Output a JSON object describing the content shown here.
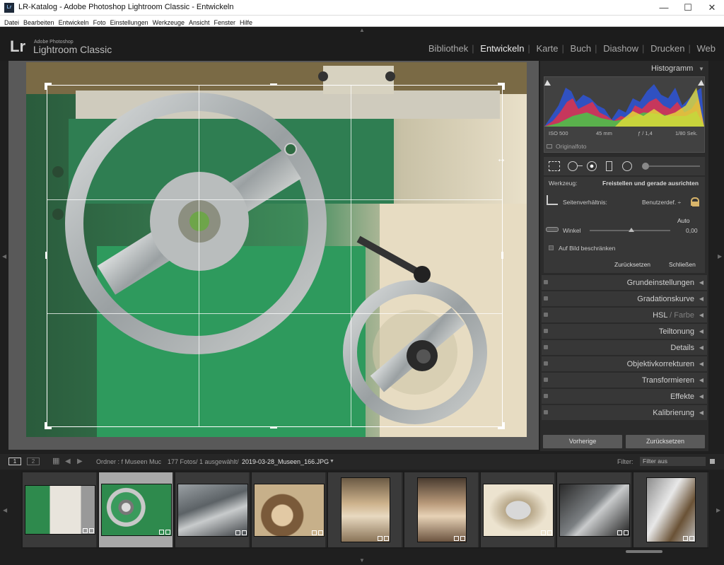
{
  "window": {
    "title": "LR-Katalog - Adobe Photoshop Lightroom Classic - Entwickeln",
    "minimize": "—",
    "maximize": "☐",
    "close": "✕"
  },
  "menu": [
    "Datei",
    "Bearbeiten",
    "Entwickeln",
    "Foto",
    "Einstellungen",
    "Werkzeuge",
    "Ansicht",
    "Fenster",
    "Hilfe"
  ],
  "identity": {
    "logo": "Lr",
    "brand_small": "Adobe Photoshop",
    "brand_large": "Lightroom Classic"
  },
  "modules": [
    {
      "label": "Bibliothek",
      "active": false
    },
    {
      "label": "Entwickeln",
      "active": true
    },
    {
      "label": "Karte",
      "active": false
    },
    {
      "label": "Buch",
      "active": false
    },
    {
      "label": "Diashow",
      "active": false
    },
    {
      "label": "Drucken",
      "active": false
    },
    {
      "label": "Web",
      "active": false
    }
  ],
  "histogram": {
    "title": "Histogramm",
    "iso": "ISO 500",
    "focal": "45 mm",
    "aperture": "ƒ / 1,4",
    "shutter": "1/80 Sek.",
    "original_label": "Originalfoto"
  },
  "crop": {
    "tool_label": "Werkzeug:",
    "tool_value": "Freistellen und gerade ausrichten",
    "aspect_label": "Seitenverhältnis:",
    "aspect_value": "Benutzerdef. ÷",
    "auto": "Auto",
    "angle_label": "Winkel",
    "angle_value": "0,00",
    "constrain_label": "Auf Bild beschränken",
    "reset": "Zurücksetzen",
    "close": "Schließen"
  },
  "sections": [
    {
      "label": "Grundeinstellungen",
      "dim": ""
    },
    {
      "label": "Gradationskurve",
      "dim": ""
    },
    {
      "label": "HSL",
      "dim": " / Farbe"
    },
    {
      "label": "Teiltonung",
      "dim": ""
    },
    {
      "label": "Details",
      "dim": ""
    },
    {
      "label": "Objektivkorrekturen",
      "dim": ""
    },
    {
      "label": "Transformieren",
      "dim": ""
    },
    {
      "label": "Effekte",
      "dim": ""
    },
    {
      "label": "Kalibrierung",
      "dim": ""
    }
  ],
  "bottom_buttons": {
    "previous": "Vorherige",
    "reset": "Zurücksetzen"
  },
  "filmstrip": {
    "view1": "1",
    "view2": "2",
    "source": "Ordner : f Museen Muc",
    "count": "177 Fotos/ 1 ausgewählt/",
    "filename": "2019-03-28_Museen_166.JPG",
    "filter_label": "Filter:",
    "filter_value": "Filter aus",
    "selected_index": 1,
    "thumbs": [
      "green-machine",
      "green-handwheel",
      "machine-gears",
      "handwheel-copper",
      "statue-1",
      "statue-2",
      "zeppelin",
      "gears-dark",
      "gear-detail"
    ]
  }
}
